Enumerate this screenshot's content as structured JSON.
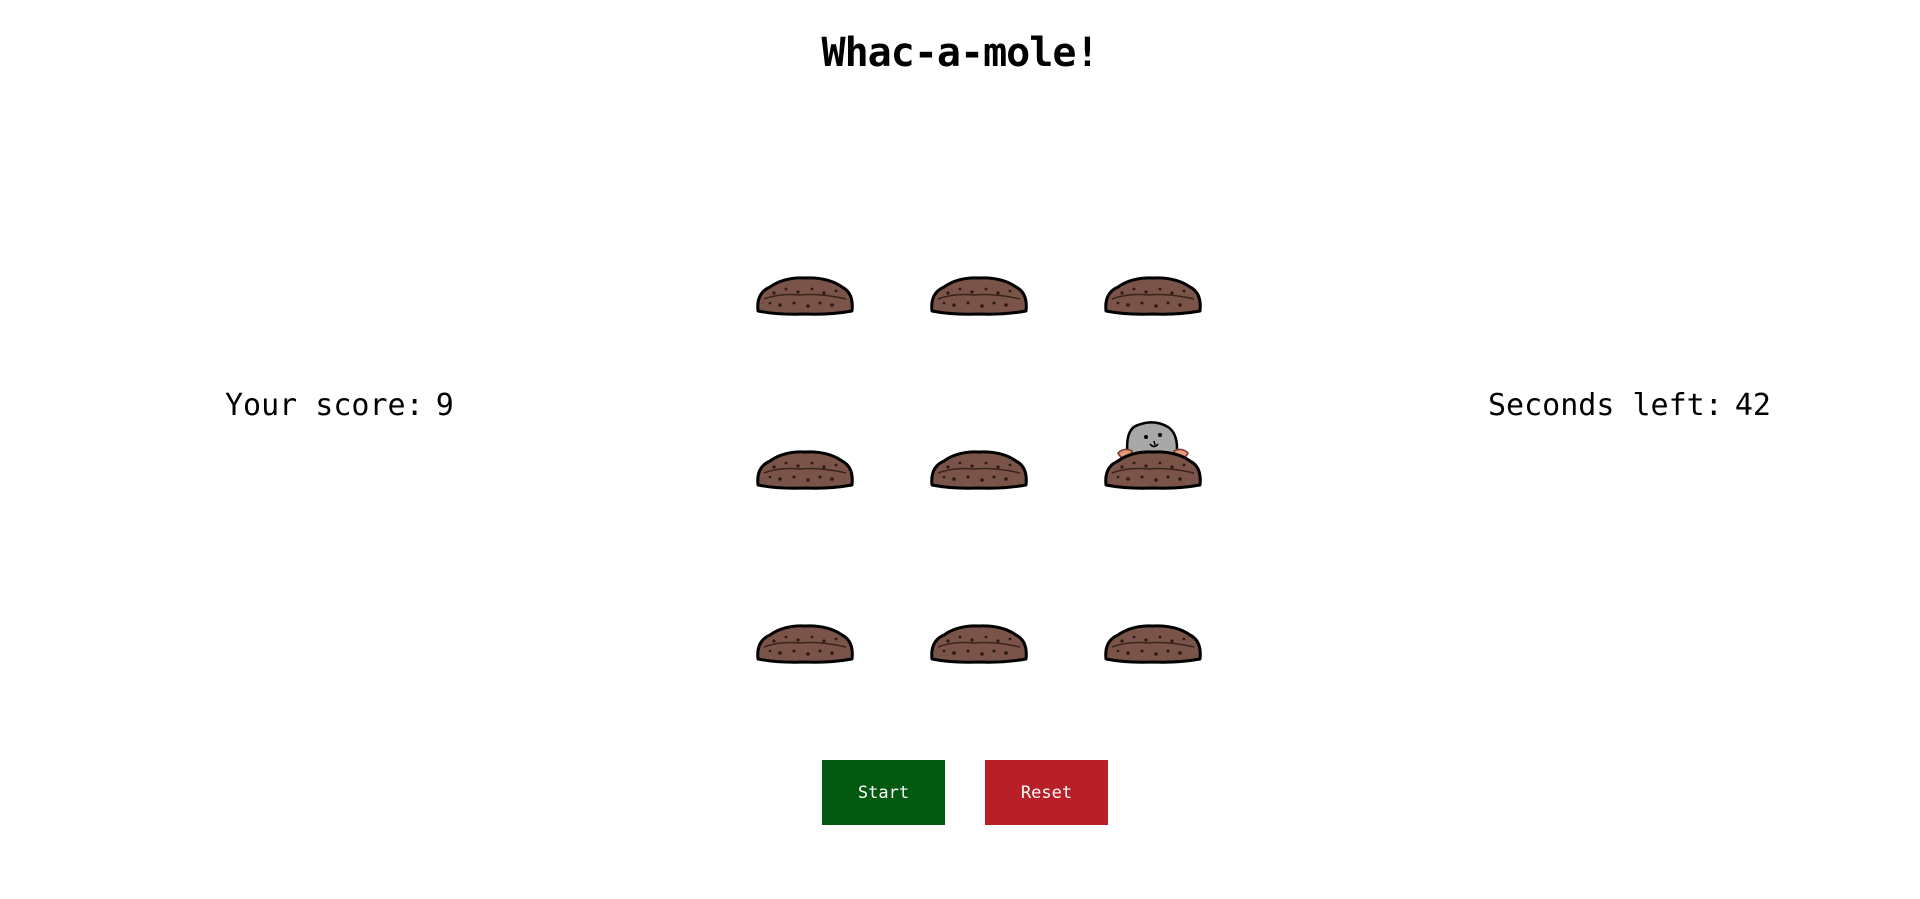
{
  "title": "Whac-a-mole!",
  "score": {
    "label": "Your score:",
    "value": "9"
  },
  "timer": {
    "label": "Seconds left:",
    "value": "42"
  },
  "board": {
    "rows": 3,
    "cols": 3,
    "holes": [
      {
        "mole": false
      },
      {
        "mole": false
      },
      {
        "mole": false
      },
      {
        "mole": false
      },
      {
        "mole": false
      },
      {
        "mole": true
      },
      {
        "mole": false
      },
      {
        "mole": false
      },
      {
        "mole": false
      }
    ]
  },
  "buttons": {
    "start": {
      "label": "Start",
      "color": "#03590f"
    },
    "reset": {
      "label": "Reset",
      "color": "#b91f27"
    }
  },
  "colors": {
    "dirt": "#7a5448",
    "dirt_outline": "#000000",
    "mole": "#a8a8a8",
    "paws": "#e49a7a"
  },
  "icons": {
    "hole": "dirt-mound-icon",
    "mole": "mole-icon"
  }
}
